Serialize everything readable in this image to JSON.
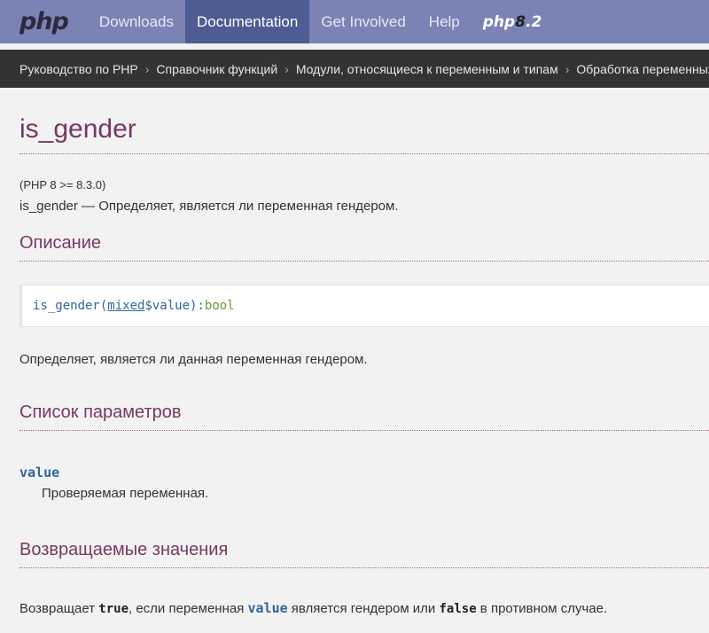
{
  "topnav": {
    "logo": "php",
    "items": [
      "Downloads",
      "Documentation",
      "Get Involved",
      "Help"
    ],
    "active_index": 1,
    "badge_prefix": "php",
    "badge_eight": "8",
    "badge_suffix": ".2"
  },
  "breadcrumbs": [
    "Руководство по PHP",
    "Справочник функций",
    "Модули, относящиеся к переменным и типам",
    "Обработка переменных"
  ],
  "page": {
    "title": "is_gender",
    "version": "(PHP 8 >= 8.3.0)",
    "purpose": "is_gender — Определяет, является ли переменная гендером."
  },
  "sections": {
    "description": {
      "heading": "Описание",
      "synopsis": {
        "name": "is_gender",
        "open": "(",
        "type": "mixed",
        "param": " $value",
        "close": "): ",
        "return_type": "bool"
      },
      "text": "Определяет, является ли данная переменная гендером."
    },
    "parameters": {
      "heading": "Список параметров",
      "items": [
        {
          "name": "value",
          "description": "Проверяемая переменная."
        }
      ]
    },
    "returns": {
      "heading": "Возвращаемые значения",
      "t1": "Возвращает ",
      "true": "true",
      "t2": ", если переменная ",
      "var": "value",
      "t3": " является гендером или ",
      "false": "false",
      "t4": " в противном случае."
    }
  },
  "colors": {
    "nav_bg": "#7b83b5",
    "nav_active": "#4f5b93",
    "breadcrumb_bg": "#333333",
    "heading": "#793862",
    "code_blue": "#336699",
    "code_green": "#669933"
  }
}
